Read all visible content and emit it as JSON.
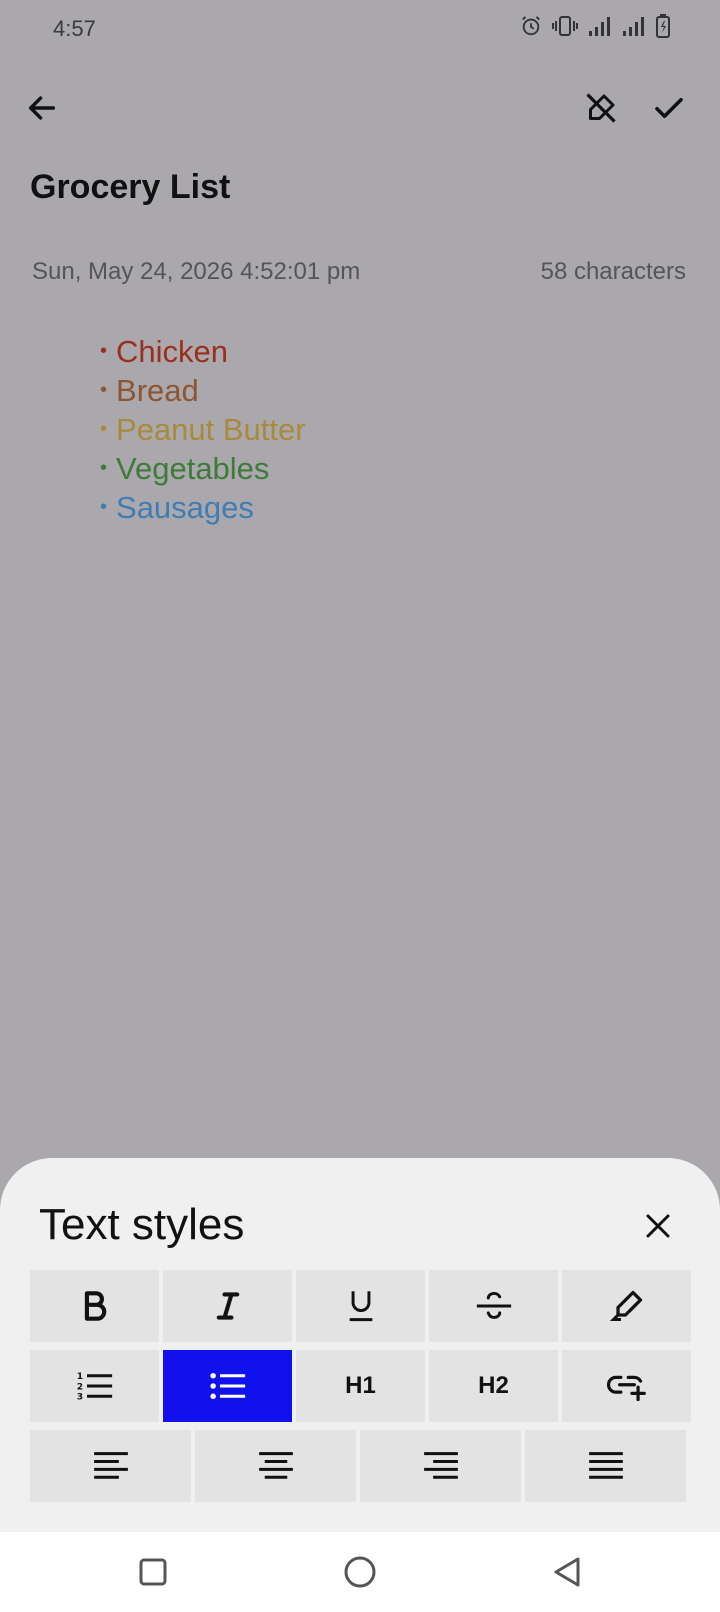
{
  "status": {
    "time": "4:57"
  },
  "note": {
    "title": "Grocery List",
    "date": "Sun, May 24, 2026 4:52:01 pm",
    "char_count": "58 characters",
    "items": [
      {
        "text": "Chicken",
        "color": "#9b2f1e"
      },
      {
        "text": "Bread",
        "color": "#8e5534"
      },
      {
        "text": "Peanut Butter",
        "color": "#a88a3c"
      },
      {
        "text": "Vegetables",
        "color": "#3f7a3a"
      },
      {
        "text": "Sausages",
        "color": "#3f7db3"
      }
    ]
  },
  "sheet": {
    "title": "Text styles",
    "buttons": {
      "h1": "H1",
      "h2": "H2"
    },
    "active_color": "#1111ee"
  },
  "icons": {
    "back": "arrow-left-icon",
    "edit_off": "edit-off-icon",
    "check": "check-icon",
    "close": "close-icon"
  }
}
